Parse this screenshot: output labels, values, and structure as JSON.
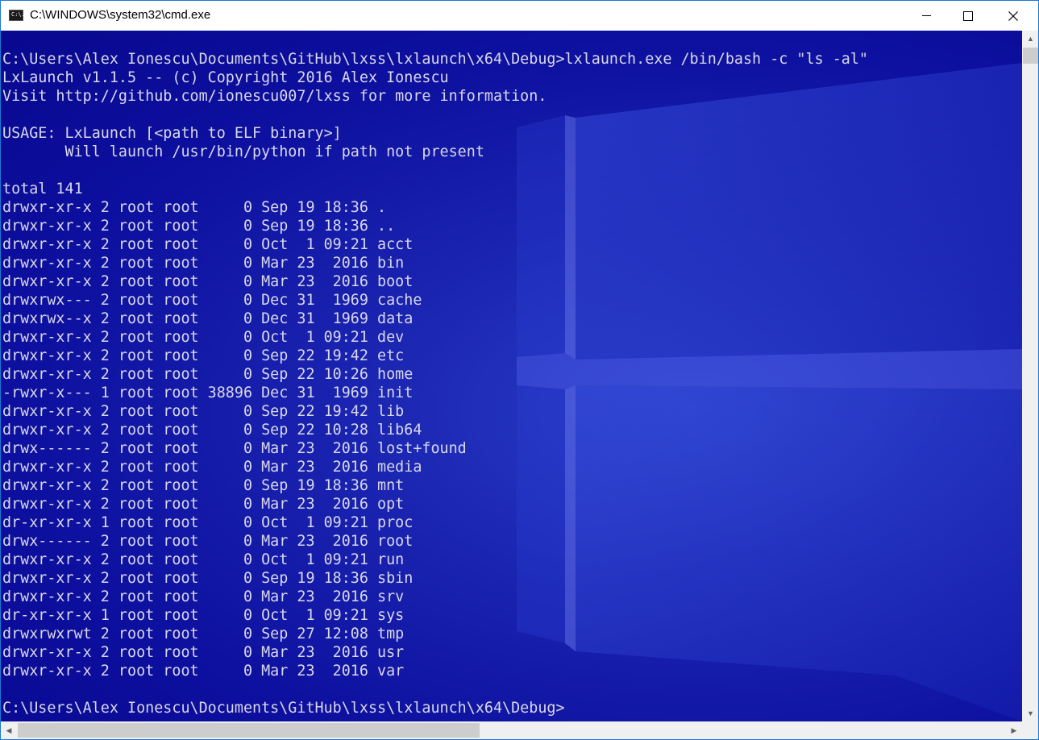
{
  "window": {
    "title": "C:\\WINDOWS\\system32\\cmd.exe",
    "icon": "cmd-icon",
    "icon_text": "C:\\.",
    "controls": {
      "minimize": "minimize-icon",
      "maximize": "maximize-icon",
      "close": "close-icon",
      "close_glyph": "✕"
    }
  },
  "colors": {
    "terminal_bg": "#0d0f9e",
    "terminal_text": "#d8d8e8",
    "window_border": "#1a78d4"
  },
  "terminal": {
    "lines": [
      "C:\\Users\\Alex Ionescu\\Documents\\GitHub\\lxss\\lxlaunch\\x64\\Debug>lxlaunch.exe /bin/bash -c \"ls -al\"",
      "LxLaunch v1.1.5 -- (c) Copyright 2016 Alex Ionescu",
      "Visit http://github.com/ionescu007/lxss for more information.",
      "",
      "USAGE: LxLaunch [<path to ELF binary>]",
      "       Will launch /usr/bin/python if path not present",
      "",
      "total 141",
      "drwxr-xr-x 2 root root     0 Sep 19 18:36 .",
      "drwxr-xr-x 2 root root     0 Sep 19 18:36 ..",
      "drwxr-xr-x 2 root root     0 Oct  1 09:21 acct",
      "drwxr-xr-x 2 root root     0 Mar 23  2016 bin",
      "drwxr-xr-x 2 root root     0 Mar 23  2016 boot",
      "drwxrwx--- 2 root root     0 Dec 31  1969 cache",
      "drwxrwx--x 2 root root     0 Dec 31  1969 data",
      "drwxr-xr-x 2 root root     0 Oct  1 09:21 dev",
      "drwxr-xr-x 2 root root     0 Sep 22 19:42 etc",
      "drwxr-xr-x 2 root root     0 Sep 22 10:26 home",
      "-rwxr-x--- 1 root root 38896 Dec 31  1969 init",
      "drwxr-xr-x 2 root root     0 Sep 22 19:42 lib",
      "drwxr-xr-x 2 root root     0 Sep 22 10:28 lib64",
      "drwx------ 2 root root     0 Mar 23  2016 lost+found",
      "drwxr-xr-x 2 root root     0 Mar 23  2016 media",
      "drwxr-xr-x 2 root root     0 Sep 19 18:36 mnt",
      "drwxr-xr-x 2 root root     0 Mar 23  2016 opt",
      "dr-xr-xr-x 1 root root     0 Oct  1 09:21 proc",
      "drwx------ 2 root root     0 Mar 23  2016 root",
      "drwxr-xr-x 2 root root     0 Oct  1 09:21 run",
      "drwxr-xr-x 2 root root     0 Sep 19 18:36 sbin",
      "drwxr-xr-x 2 root root     0 Mar 23  2016 srv",
      "dr-xr-xr-x 1 root root     0 Oct  1 09:21 sys",
      "drwxrwxrwt 2 root root     0 Sep 27 12:08 tmp",
      "drwxr-xr-x 2 root root     0 Mar 23  2016 usr",
      "drwxr-xr-x 2 root root     0 Mar 23  2016 var",
      "",
      "C:\\Users\\Alex Ionescu\\Documents\\GitHub\\lxss\\lxlaunch\\x64\\Debug>"
    ]
  },
  "scrollbars": {
    "vertical": {
      "up": "scroll-up-arrow-icon",
      "down": "scroll-down-arrow-icon",
      "up_glyph": "▲",
      "down_glyph": "▼"
    },
    "horizontal": {
      "left": "scroll-left-arrow-icon",
      "right": "scroll-right-arrow-icon",
      "left_glyph": "◀",
      "right_glyph": "▶"
    }
  }
}
